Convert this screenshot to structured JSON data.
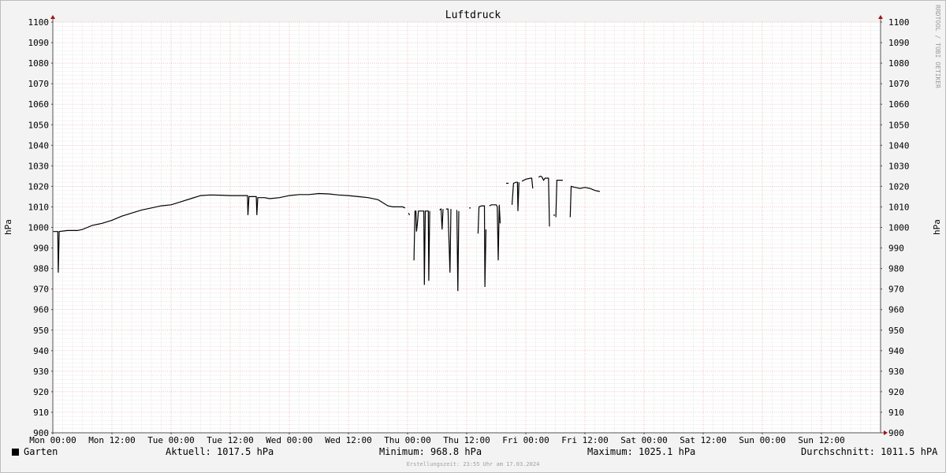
{
  "chart_data": {
    "type": "line",
    "title": "Luftdruck",
    "ylabel": "hPa",
    "ylim": [
      900,
      1100
    ],
    "yticks": [
      900,
      910,
      920,
      930,
      940,
      950,
      960,
      970,
      980,
      990,
      1000,
      1010,
      1020,
      1030,
      1040,
      1050,
      1060,
      1070,
      1080,
      1090,
      1100
    ],
    "xlim_hours": [
      0,
      168
    ],
    "xticks": [
      {
        "h": 0,
        "label": "Mon 00:00"
      },
      {
        "h": 12,
        "label": "Mon 12:00"
      },
      {
        "h": 24,
        "label": "Tue 00:00"
      },
      {
        "h": 36,
        "label": "Tue 12:00"
      },
      {
        "h": 48,
        "label": "Wed 00:00"
      },
      {
        "h": 60,
        "label": "Wed 12:00"
      },
      {
        "h": 72,
        "label": "Thu 00:00"
      },
      {
        "h": 84,
        "label": "Thu 12:00"
      },
      {
        "h": 96,
        "label": "Fri 00:00"
      },
      {
        "h": 108,
        "label": "Fri 12:00"
      },
      {
        "h": 120,
        "label": "Sat 00:00"
      },
      {
        "h": 132,
        "label": "Sat 12:00"
      },
      {
        "h": 144,
        "label": "Sun 00:00"
      },
      {
        "h": 156,
        "label": "Sun 12:00"
      }
    ],
    "grid": true,
    "series": [
      {
        "name": "Garten",
        "color": "#000000",
        "segments": [
          [
            [
              0,
              998
            ],
            [
              1,
              998
            ],
            [
              1.1,
              978
            ],
            [
              1.3,
              998
            ],
            [
              3,
              998.5
            ],
            [
              5,
              998.5
            ],
            [
              6,
              999
            ],
            [
              7,
              1000
            ],
            [
              8,
              1001
            ],
            [
              10,
              1002
            ],
            [
              12,
              1003.5
            ],
            [
              14,
              1005.5
            ],
            [
              16,
              1007
            ],
            [
              18,
              1008.5
            ],
            [
              20,
              1009.5
            ],
            [
              22,
              1010.5
            ],
            [
              24,
              1011
            ],
            [
              26,
              1012.5
            ],
            [
              28,
              1014
            ],
            [
              30,
              1015.5
            ],
            [
              32,
              1015.8
            ],
            [
              34,
              1015.7
            ],
            [
              36,
              1015.5
            ],
            [
              38,
              1015.5
            ],
            [
              39.5,
              1015.5
            ],
            [
              39.6,
              1006
            ],
            [
              39.8,
              1015
            ],
            [
              41.3,
              1015
            ],
            [
              41.4,
              1006
            ],
            [
              41.6,
              1014.5
            ],
            [
              43,
              1014.5
            ],
            [
              44,
              1014
            ],
            [
              46,
              1014.5
            ],
            [
              48,
              1015.5
            ],
            [
              50,
              1016
            ],
            [
              52,
              1016
            ],
            [
              54,
              1016.5
            ],
            [
              56,
              1016.3
            ],
            [
              58,
              1015.8
            ],
            [
              60,
              1015.5
            ],
            [
              62,
              1015
            ],
            [
              64,
              1014.5
            ],
            [
              66,
              1013.5
            ],
            [
              67,
              1012
            ],
            [
              68,
              1010.5
            ],
            [
              69,
              1010
            ],
            [
              70,
              1010
            ],
            [
              71,
              1010
            ],
            [
              71.5,
              1009.5
            ]
          ],
          [
            [
              72.2,
              1007
            ],
            [
              72.4,
              1006
            ]
          ],
          [
            [
              73.3,
              984
            ],
            [
              73.5,
              1008
            ],
            [
              73.7,
              1008
            ],
            [
              73.8,
              998
            ],
            [
              74,
              1002
            ],
            [
              74.2,
              1008
            ],
            [
              74.6,
              1008
            ],
            [
              74.7,
              1008
            ],
            [
              75.3,
              1008
            ],
            [
              75.4,
              972
            ],
            [
              75.6,
              1008
            ],
            [
              76.2,
              1008
            ],
            [
              76.3,
              974
            ],
            [
              76.5,
              1008
            ]
          ],
          [
            [
              78.5,
              1008.5
            ],
            [
              78.8,
              1009
            ],
            [
              79,
              999
            ],
            [
              79.2,
              1009
            ]
          ],
          [
            [
              79.8,
              1009
            ],
            [
              80.2,
              1009
            ],
            [
              80.6,
              978
            ],
            [
              80.8,
              1009
            ]
          ],
          [
            [
              82,
              1008.5
            ],
            [
              82.2,
              969
            ],
            [
              82.4,
              1008
            ]
          ],
          [
            [
              84.5,
              1009.5
            ],
            [
              84.8,
              1009.5
            ]
          ],
          [
            [
              86.3,
              997
            ],
            [
              86.5,
              1010
            ],
            [
              87,
              1010.5
            ],
            [
              87.6,
              1010.5
            ],
            [
              87.7,
              971
            ],
            [
              87.9,
              999
            ]
          ],
          [
            [
              88.6,
              1010.5
            ],
            [
              89,
              1011
            ],
            [
              90,
              1011
            ],
            [
              90.2,
              1010
            ],
            [
              90.4,
              984
            ],
            [
              90.6,
              1011
            ],
            [
              90.8,
              1002
            ]
          ],
          [
            [
              92,
              1021.5
            ],
            [
              92.5,
              1021.5
            ]
          ],
          [
            [
              93.2,
              1011
            ],
            [
              93.5,
              1021.5
            ],
            [
              94,
              1022
            ],
            [
              94.3,
              1022
            ],
            [
              94.4,
              1008
            ],
            [
              94.6,
              1022
            ]
          ],
          [
            [
              95.2,
              1022.5
            ],
            [
              96,
              1023.5
            ],
            [
              97,
              1024
            ],
            [
              97.2,
              1024
            ],
            [
              97.4,
              1019
            ]
          ],
          [
            [
              98.6,
              1024.5
            ],
            [
              99,
              1025
            ],
            [
              99.3,
              1024.5
            ],
            [
              99.6,
              1023
            ],
            [
              99.9,
              1024
            ],
            [
              100.6,
              1024
            ],
            [
              100.8,
              1000.5
            ]
          ],
          [
            [
              101.6,
              1006
            ],
            [
              101.9,
              1006
            ]
          ],
          [
            [
              102.1,
              1005
            ],
            [
              102.3,
              1023
            ],
            [
              103,
              1023
            ],
            [
              103.5,
              1023
            ]
          ],
          [
            [
              105,
              1005
            ],
            [
              105.2,
              1020
            ],
            [
              106,
              1019.5
            ],
            [
              107,
              1019
            ],
            [
              108,
              1019.5
            ],
            [
              109,
              1019
            ],
            [
              110,
              1018
            ],
            [
              111,
              1017.5
            ]
          ]
        ]
      }
    ],
    "watermark": "RRDTOOL / TOBI OETIKER"
  },
  "legend": {
    "series_label": "Garten",
    "current": "Aktuell: 1017.5 hPa",
    "minimum": "Minimum: 968.8 hPa",
    "maximum": "Maximum: 1025.1 hPa",
    "average": "Durchschnitt: 1011.5 hPA"
  },
  "footer": "Erstellungszeit: 23:55 Uhr am 17.03.2024"
}
